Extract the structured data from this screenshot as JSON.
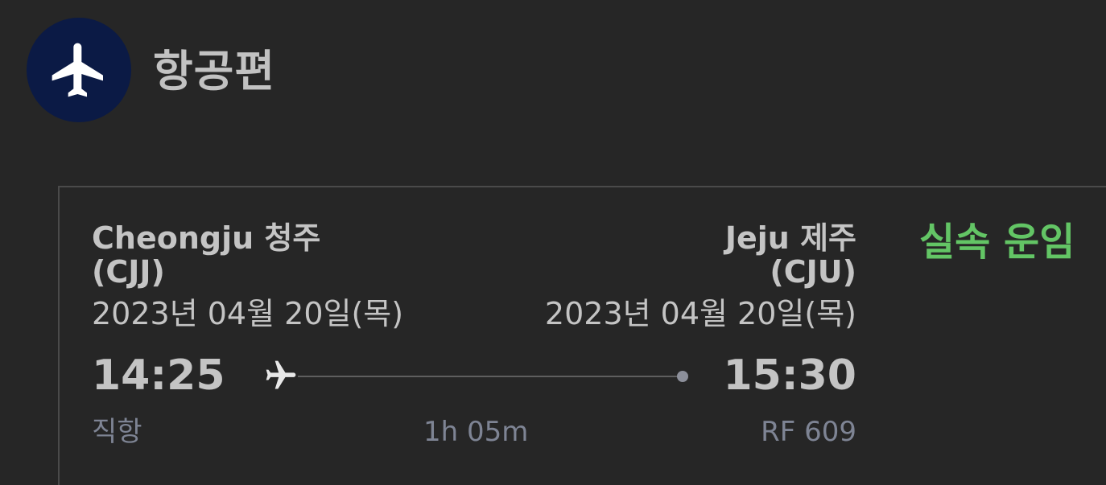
{
  "header": {
    "icon": "airplane-icon",
    "icon_bg_color": "#0b1a45",
    "title": "항공편"
  },
  "flight": {
    "origin": {
      "city": "Cheongju 청주",
      "code": "(CJJ)",
      "date": "2023년 04월 20일(목)",
      "time": "14:25"
    },
    "destination": {
      "city": "Jeju 제주",
      "code": "(CJU)",
      "date": "2023년 04월 20일(목)",
      "time": "15:30"
    },
    "route_icon": "airplane-icon",
    "type": "직항",
    "duration": "1h 05m",
    "flight_number": "RF 609",
    "status": "실속 운임",
    "status_color": "#63c565"
  }
}
